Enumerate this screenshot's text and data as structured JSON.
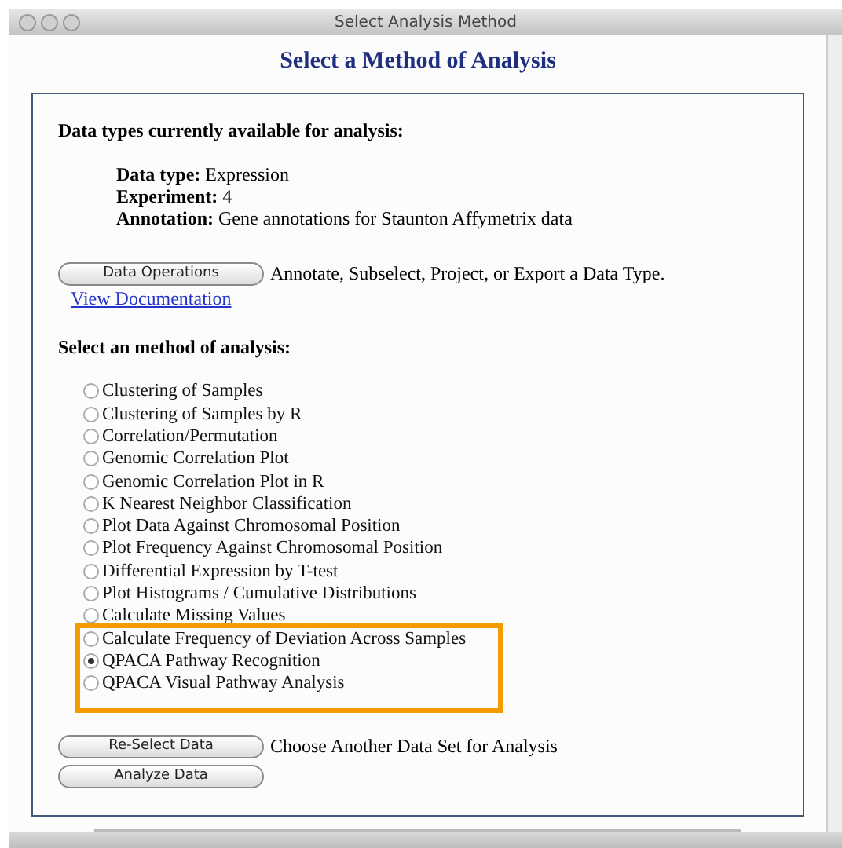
{
  "window": {
    "title": "Select Analysis Method"
  },
  "heading": "Select a Method of Analysis",
  "data_types": {
    "title": "Data types currently available for analysis:",
    "fields": [
      {
        "label": "Data type:",
        "value": "Expression"
      },
      {
        "label": "Experiment:",
        "value": "4"
      },
      {
        "label": "Annotation:",
        "value": "Gene annotations for Staunton Affymetrix data"
      }
    ]
  },
  "data_operations": {
    "button": "Data Operations",
    "text": "Annotate, Subselect, Project, or Export a Data Type.",
    "link": "View Documentation"
  },
  "methods": {
    "title": "Select an method of analysis:",
    "items": [
      {
        "label": "Clustering of Samples",
        "selected": false,
        "highlighted": false
      },
      {
        "label": "Clustering of Samples by R",
        "selected": false,
        "highlighted": false
      },
      {
        "label": "Correlation/Permutation",
        "selected": false,
        "highlighted": false
      },
      {
        "label": "Genomic Correlation Plot",
        "selected": false,
        "highlighted": false
      },
      {
        "label": "Genomic Correlation Plot in R",
        "selected": false,
        "highlighted": false
      },
      {
        "label": "K Nearest Neighbor Classification",
        "selected": false,
        "highlighted": false
      },
      {
        "label": "Plot Data Against Chromosomal Position",
        "selected": false,
        "highlighted": false
      },
      {
        "label": "Plot Frequency Against Chromosomal Position",
        "selected": false,
        "highlighted": false
      },
      {
        "label": "Differential Expression by T-test",
        "selected": false,
        "highlighted": false
      },
      {
        "label": "Plot Histograms / Cumulative Distributions",
        "selected": false,
        "highlighted": false
      },
      {
        "label": "Calculate Missing Values",
        "selected": false,
        "highlighted": false
      },
      {
        "label": "Calculate Frequency of Deviation Across Samples",
        "selected": false,
        "highlighted": true
      },
      {
        "label": "QPACA Pathway Recognition",
        "selected": true,
        "highlighted": true
      },
      {
        "label": "QPACA Visual Pathway Analysis",
        "selected": false,
        "highlighted": true
      }
    ]
  },
  "reselect": {
    "button": "Re-Select Data",
    "text": "Choose Another Data Set for Analysis"
  },
  "analyze": {
    "button": "Analyze Data"
  }
}
